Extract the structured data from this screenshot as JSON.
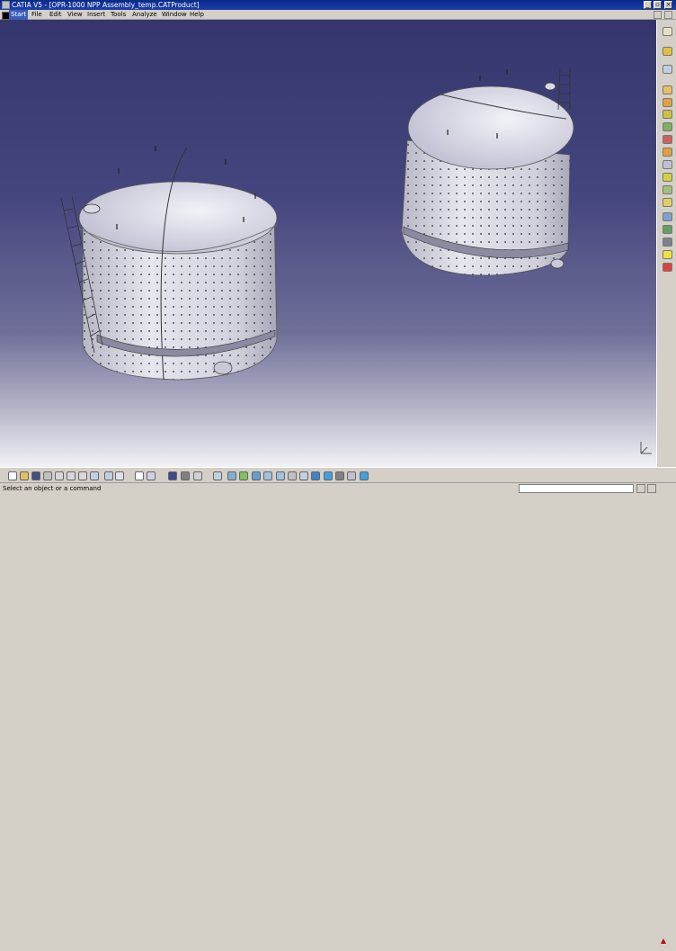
{
  "window": {
    "title": "CATIA V5 - [OPR-1000 NPP Assembly_temp.CATProduct]"
  },
  "menu": {
    "items": [
      "Start",
      "File",
      "Edit",
      "View",
      "Insert",
      "Tools",
      "Analyze",
      "Window",
      "Help"
    ]
  },
  "viewport": {
    "model": "Two cylindrical storage tanks with domed roofs, ladders and rivet rows",
    "background_top": "#36366e",
    "background_bottom": "#f2f2f6"
  },
  "status": {
    "message": "Select an object or a command",
    "command_value": ""
  },
  "colors": {
    "title_bar": "#0a2a8a",
    "tank_body": "#d8d8e4",
    "tank_roof": "#dcdcea",
    "chrome": "#d4d0c8"
  }
}
